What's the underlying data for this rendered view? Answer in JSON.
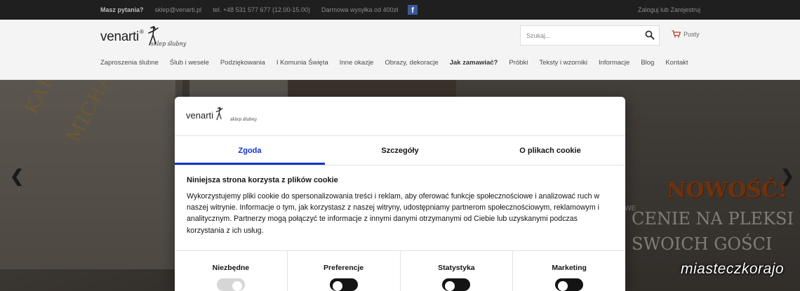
{
  "topbar": {
    "question": "Masz pytania?",
    "email": "sklep@venarti.pl",
    "phone": "tel. +48 531 577 677 (12.00-15.00)",
    "shipping": "Darmowa wysyłka od 400zł",
    "facebook_letter": "f",
    "login": "Zaloguj lub Zarejestruj"
  },
  "header": {
    "logo_brand": "venarti",
    "logo_reg": "®",
    "logo_script": "sklep ślubny",
    "search_placeholder": "Szukaj...",
    "cart_label": "Pusty"
  },
  "nav": [
    {
      "label": "Zaproszenia ślubne",
      "bold": false
    },
    {
      "label": "Ślub i wesele",
      "bold": false
    },
    {
      "label": "Podziękowania",
      "bold": false
    },
    {
      "label": "I Komunia Święta",
      "bold": false
    },
    {
      "label": "Inne okazje",
      "bold": false
    },
    {
      "label": "Obrazy, dekoracje",
      "bold": false
    },
    {
      "label": "Jak zamawiać?",
      "bold": true
    },
    {
      "label": "Próbki",
      "bold": false
    },
    {
      "label": "Teksty i wzorniki",
      "bold": false
    },
    {
      "label": "Informacje",
      "bold": false
    },
    {
      "label": "Blog",
      "bold": false
    },
    {
      "label": "Kontakt",
      "bold": false
    }
  ],
  "hero": {
    "prev_arrow": "❮",
    "next_arrow": "❯",
    "names_1": "KAROLINA",
    "names_2": "MICHAŁ",
    "promo_new": "NOWOŚĆ!",
    "promo_line1": "CENIE NA PLEKSI",
    "promo_line2": "SWOICH GOŚCI",
    "promo_small": "WE"
  },
  "watermark": "miasteczkorajo",
  "cookie": {
    "logo_brand": "venarti",
    "logo_script": "sklep ślubny",
    "tabs": [
      {
        "label": "Zgoda",
        "active": true
      },
      {
        "label": "Szczegóły",
        "active": false
      },
      {
        "label": "O plikach cookie",
        "active": false
      }
    ],
    "heading": "Niniejsza strona korzysta z plików cookie",
    "body": "Wykorzystujemy pliki cookie do spersonalizowania treści i reklam, aby oferować funkcje społecznościowe i analizować ruch w naszej witrynie. Informacje o tym, jak korzystasz z naszej witryny, udostępniamy partnerom społecznościowym, reklamowym i analitycznym. Partnerzy mogą połączyć te informacje z innymi danymi otrzymanymi od Ciebie lub uzyskanymi podczas korzystania z ich usług.",
    "categories": [
      {
        "label": "Niezbędne",
        "enabled": true,
        "locked": true
      },
      {
        "label": "Preferencje",
        "enabled": false,
        "locked": false
      },
      {
        "label": "Statystyka",
        "enabled": false,
        "locked": false
      },
      {
        "label": "Marketing",
        "enabled": false,
        "locked": false
      }
    ]
  }
}
